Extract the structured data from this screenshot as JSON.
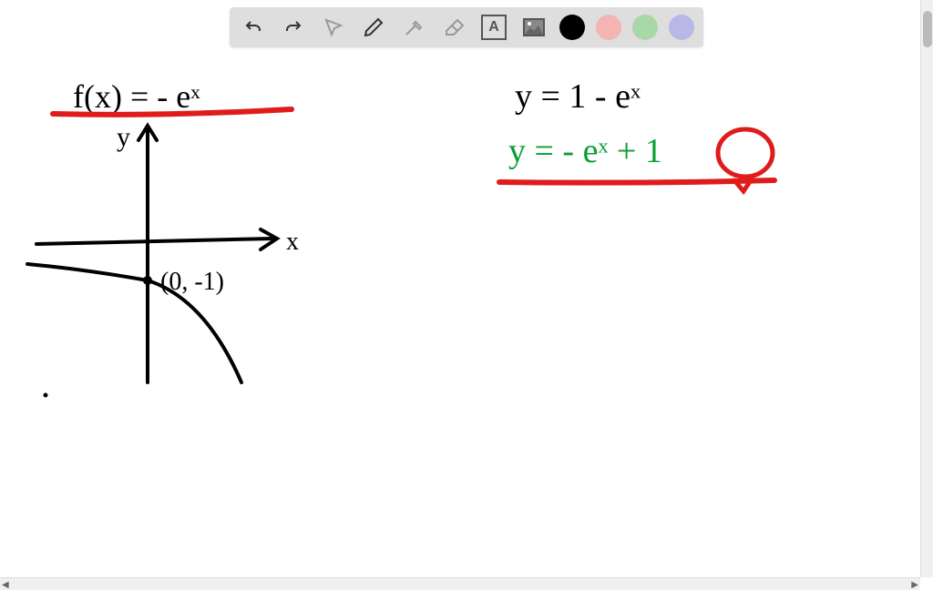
{
  "toolbar": {
    "tools": {
      "undo": "undo",
      "redo": "redo",
      "pointer": "pointer",
      "pencil": "pencil",
      "tools_disabled": "tools",
      "eraser": "eraser",
      "text": "A",
      "image": "image"
    },
    "colors": [
      "#000000",
      "#f4b4b4",
      "#a8d8a8",
      "#b8b8e8"
    ],
    "selected_color": "#000000"
  },
  "content": {
    "equation_left": "f(x) = - eˣ",
    "axis_y_label": "y",
    "axis_x_label": "x",
    "point_label": "(0, -1)",
    "equation_right_1": "y = 1 - eˣ",
    "equation_right_2": "y = - eˣ + 1"
  },
  "colors_used": {
    "black": "#000000",
    "red": "#e01b1b",
    "green": "#0a9e33"
  }
}
